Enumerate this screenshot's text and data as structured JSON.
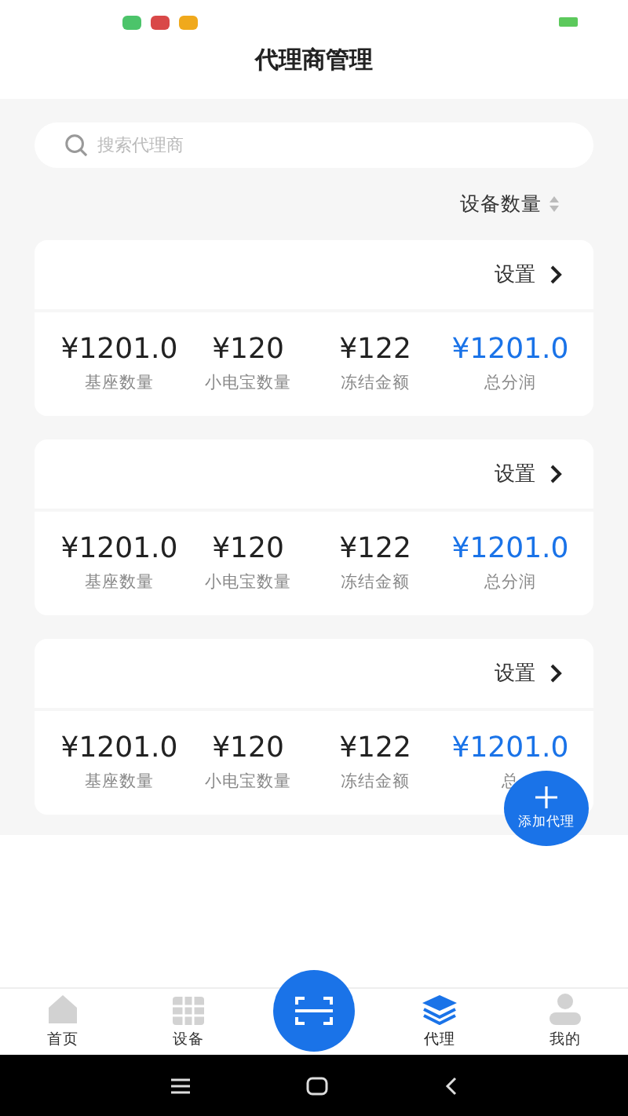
{
  "title": "代理商管理",
  "search": {
    "placeholder": "搜索代理商"
  },
  "sort": {
    "label": "设备数量"
  },
  "agents": [
    {
      "settings_label": "设置",
      "stats": [
        {
          "value": "¥1201.0",
          "label": "基座数量",
          "highlight": false
        },
        {
          "value": "¥120",
          "label": "小电宝数量",
          "highlight": false
        },
        {
          "value": "¥122",
          "label": "冻结金额",
          "highlight": false
        },
        {
          "value": "¥1201.0",
          "label": "总分润",
          "highlight": true
        }
      ]
    },
    {
      "settings_label": "设置",
      "stats": [
        {
          "value": "¥1201.0",
          "label": "基座数量",
          "highlight": false
        },
        {
          "value": "¥120",
          "label": "小电宝数量",
          "highlight": false
        },
        {
          "value": "¥122",
          "label": "冻结金额",
          "highlight": false
        },
        {
          "value": "¥1201.0",
          "label": "总分润",
          "highlight": true
        }
      ]
    },
    {
      "settings_label": "设置",
      "stats": [
        {
          "value": "¥1201.0",
          "label": "基座数量",
          "highlight": false
        },
        {
          "value": "¥120",
          "label": "小电宝数量",
          "highlight": false
        },
        {
          "value": "¥122",
          "label": "冻结金额",
          "highlight": false
        },
        {
          "value": "¥1201.0",
          "label": "总",
          "highlight": true
        }
      ]
    }
  ],
  "fab": {
    "label": "添加代理"
  },
  "nav": [
    {
      "kind": "home",
      "label": "首页",
      "selected": false
    },
    {
      "kind": "grid",
      "label": "设备",
      "selected": false
    },
    {
      "kind": "scan",
      "selected": false
    },
    {
      "kind": "layers",
      "label": "代理",
      "selected": true
    },
    {
      "kind": "user",
      "label": "我的",
      "selected": false
    }
  ]
}
